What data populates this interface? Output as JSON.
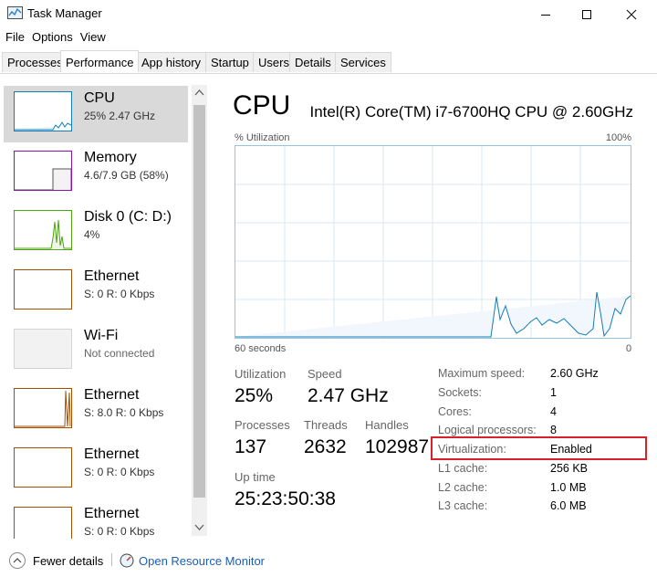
{
  "window": {
    "title": "Task Manager"
  },
  "menu": [
    "File",
    "Options",
    "View"
  ],
  "tabs": [
    "Processes",
    "Performance",
    "App history",
    "Startup",
    "Users",
    "Details",
    "Services"
  ],
  "sidebar": {
    "items": [
      {
        "name": "CPU",
        "sub": "25% 2.47 GHz"
      },
      {
        "name": "Memory",
        "sub": "4.6/7.9 GB (58%)"
      },
      {
        "name": "Disk 0 (C: D:)",
        "sub": "4%"
      },
      {
        "name": "Ethernet",
        "sub": "S: 0 R: 0 Kbps"
      },
      {
        "name": "Wi-Fi",
        "sub": "Not connected"
      },
      {
        "name": "Ethernet",
        "sub": "S: 8.0 R: 0 Kbps"
      },
      {
        "name": "Ethernet",
        "sub": "S: 0 R: 0 Kbps"
      },
      {
        "name": "Ethernet",
        "sub": "S: 0 R: 0 Kbps"
      }
    ]
  },
  "main": {
    "title": "CPU",
    "model": "Intel(R) Core(TM) i7-6700HQ CPU @ 2.60GHz",
    "graph": {
      "top_left": "% Utilization",
      "top_right": "100%",
      "bottom_left": "60 seconds",
      "bottom_right": "0"
    },
    "stats": {
      "utilization_label": "Utilization",
      "utilization_value": "25%",
      "speed_label": "Speed",
      "speed_value": "2.47 GHz",
      "processes_label": "Processes",
      "processes_value": "137",
      "threads_label": "Threads",
      "threads_value": "2632",
      "handles_label": "Handles",
      "handles_value": "102987",
      "uptime_label": "Up time",
      "uptime_value": "25:23:50:38"
    },
    "info": [
      {
        "label": "Maximum speed:",
        "value": "2.60 GHz"
      },
      {
        "label": "Sockets:",
        "value": "1"
      },
      {
        "label": "Cores:",
        "value": "4"
      },
      {
        "label": "Logical processors:",
        "value": "8"
      },
      {
        "label": "Virtualization:",
        "value": "Enabled"
      },
      {
        "label": "L1 cache:",
        "value": "256 KB"
      },
      {
        "label": "L2 cache:",
        "value": "1.0 MB"
      },
      {
        "label": "L3 cache:",
        "value": "6.0 MB"
      }
    ]
  },
  "footer": {
    "fewer_details": "Fewer details",
    "open_resource_monitor": "Open Resource Monitor"
  },
  "colors": {
    "cpu": "#117dbb",
    "memory": "#8b12ae",
    "disk": "#4da60c",
    "ethernet": "#a74f01",
    "wifi": "#bcbcbc",
    "highlight": "#d9212c"
  }
}
